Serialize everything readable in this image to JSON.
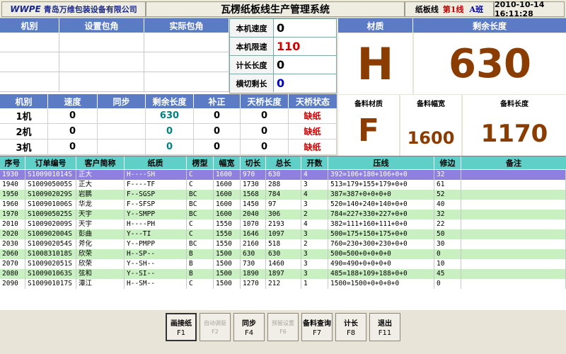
{
  "titlebar": {
    "logo": "WWPE",
    "company": "青岛万维包装设备有限公司",
    "system": "瓦楞纸板线生产管理系统",
    "line_label": "纸板线",
    "line_value": "第1线",
    "shift": "A班",
    "datetime": "2010-10-14 16:11:28"
  },
  "angle_table": {
    "headers": [
      "机别",
      "设置包角",
      "实际包角"
    ]
  },
  "speed_box": {
    "rows": [
      {
        "label": "本机速度",
        "value": "0",
        "color": "#000000"
      },
      {
        "label": "本机限速",
        "value": "110",
        "color": "#d00000"
      },
      {
        "label": "计长长度",
        "value": "0",
        "color": "#000000"
      },
      {
        "label": "横切剩长",
        "value": "0",
        "color": "#0000c0"
      }
    ]
  },
  "material": {
    "header": "材质",
    "value": "H",
    "remaining_header": "剩余长度",
    "remaining_value": "630"
  },
  "standby": {
    "material_label": "备料材质",
    "material_value": "F",
    "width_label": "备料幅宽",
    "width_value": "1600",
    "length_label": "备料长度",
    "length_value": "1170"
  },
  "machine_table": {
    "headers": [
      "机别",
      "速度",
      "同步",
      "剩余长度",
      "补正",
      "天桥长度",
      "天桥状态"
    ],
    "rows": [
      {
        "name": "1机",
        "speed": "0",
        "sync": "",
        "remaining": "630",
        "correction": "0",
        "bridge": "0",
        "status": "缺纸"
      },
      {
        "name": "2机",
        "speed": "0",
        "sync": "",
        "remaining": "0",
        "correction": "0",
        "bridge": "0",
        "status": "缺纸"
      },
      {
        "name": "3机",
        "speed": "0",
        "sync": "",
        "remaining": "0",
        "correction": "0",
        "bridge": "0",
        "status": "缺纸"
      }
    ]
  },
  "order_table": {
    "headers": [
      "序号",
      "订单编号",
      "客户简称",
      "纸质",
      "楞型",
      "幅宽",
      "切长",
      "总长",
      "开数",
      "压线",
      "修边",
      "备注"
    ],
    "rows": [
      [
        "1930",
        "S100901014S",
        "正大",
        "H----SH",
        "C",
        "1600",
        "970",
        "630",
        "4",
        "392=106+180+106+0+0",
        "32",
        ""
      ],
      [
        "1940",
        "S100905005S",
        "正大",
        "F----TF",
        "C",
        "1600",
        "1730",
        "288",
        "3",
        "513=179+155+179+0+0",
        "61",
        ""
      ],
      [
        "1950",
        "S100902029S",
        "岩鹏",
        "F--SGSP",
        "BC",
        "1600",
        "1568",
        "784",
        "4",
        "387=387+0+0+0+0",
        "52",
        ""
      ],
      [
        "1960",
        "S100901006S",
        "华龙",
        "F--SFSP",
        "BC",
        "1600",
        "1450",
        "97",
        "3",
        "520=140+240+140+0+0",
        "40",
        ""
      ],
      [
        "1970",
        "S100905025S",
        "天宇",
        "Y--SMPP",
        "BC",
        "1600",
        "2040",
        "306",
        "2",
        "784=227+330+227+0+0",
        "32",
        ""
      ],
      [
        "2010",
        "S100902009S",
        "天宇",
        "H----PH",
        "C",
        "1550",
        "1070",
        "2193",
        "4",
        "382=111+160+111+0+0",
        "22",
        ""
      ],
      [
        "2020",
        "S100902004S",
        "彭曲",
        "Y---TI",
        "C",
        "1550",
        "1646",
        "1097",
        "3",
        "500=175+150+175+0+0",
        "50",
        ""
      ],
      [
        "2030",
        "S100902054S",
        "斧化",
        "Y--PMPP",
        "BC",
        "1550",
        "2160",
        "518",
        "2",
        "760=230+300+230+0+0",
        "30",
        ""
      ],
      [
        "2060",
        "S100831018S",
        "欣荣",
        "H--SP--",
        "B",
        "1500",
        "630",
        "630",
        "3",
        "500=500+0+0+0+0",
        "0",
        ""
      ],
      [
        "2070",
        "S100902051S",
        "欣荣",
        "Y--SH--",
        "B",
        "1500",
        "730",
        "1460",
        "3",
        "490=490+0+0+0+0",
        "10",
        ""
      ],
      [
        "2080",
        "S100901063S",
        "弦和",
        "Y--SI--",
        "B",
        "1500",
        "1890",
        "1897",
        "3",
        "485=188+109+188+0+0",
        "45",
        ""
      ],
      [
        "2090",
        "S100901017S",
        "潭江",
        "H--SM--",
        "C",
        "1500",
        "1270",
        "212",
        "1",
        "1500=1500+0+0+0+0",
        "0",
        ""
      ]
    ]
  },
  "buttons": [
    {
      "label": "画接纸",
      "key": "F1",
      "enabled": true,
      "focus": true
    },
    {
      "label": "自动调驱",
      "key": "F2",
      "enabled": false
    },
    {
      "label": "同步",
      "key": "F4",
      "enabled": true
    },
    {
      "label": "预留设置",
      "key": "F6",
      "enabled": false
    },
    {
      "label": "备料查询",
      "key": "F7",
      "enabled": true
    },
    {
      "label": "计长",
      "key": "F8",
      "enabled": true
    },
    {
      "label": "退出",
      "key": "F11",
      "enabled": true
    }
  ]
}
